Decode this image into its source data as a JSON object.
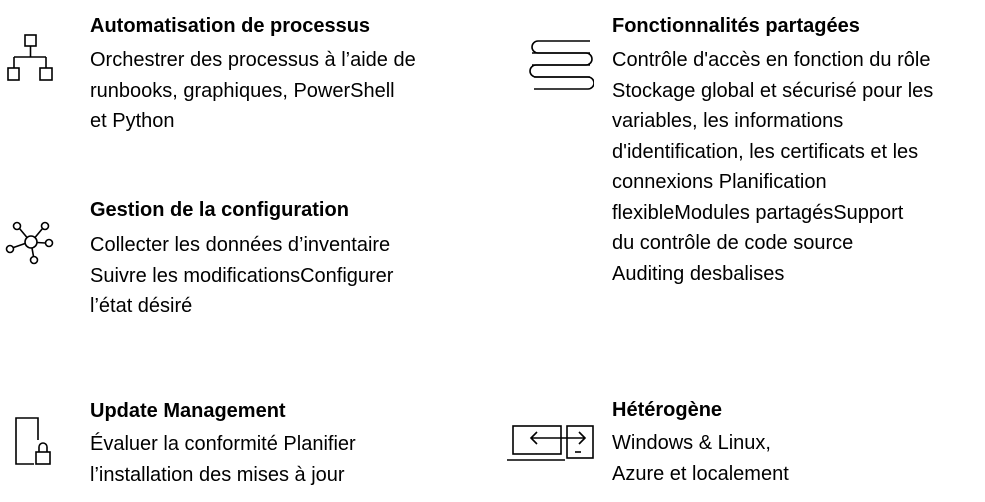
{
  "features": [
    {
      "title": "Automatisation de processus",
      "icon": "hierarchy-icon",
      "lines": [
        "Orchestrer des processus à l’aide de",
        "runbooks, graphiques, PowerShell",
        "et Python"
      ]
    },
    {
      "title": "Gestion de la configuration",
      "icon": "network-hub-icon",
      "lines": [
        "Collecter les données d’inventaire",
        "Suivre les modificationsConfigurer",
        "l’état désiré"
      ]
    },
    {
      "title": "Update Management",
      "icon": "document-lock-icon",
      "lines": [
        "Évaluer la conformité Planifier",
        "l’installation des mises à jour"
      ]
    },
    {
      "title": "Fonctionnalités partagées",
      "icon": "book-stack-icon",
      "lines": [
        "Contrôle d'accès en fonction du rôle",
        "Stockage global et sécurisé pour les",
        "variables, les informations",
        "d'identification, les certificats et les",
        "connexions Planification",
        "flexibleModules partagésSupport",
        "du contrôle de code source",
        "Auditing desbalises"
      ]
    },
    {
      "title": "Hétérogène",
      "icon": "hybrid-devices-icon",
      "lines": [
        "Windows & Linux,",
        "Azure et localement"
      ]
    }
  ]
}
